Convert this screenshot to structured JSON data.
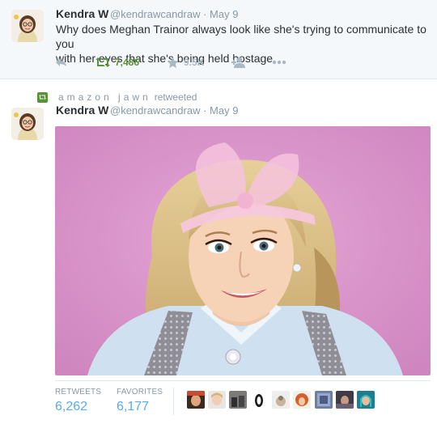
{
  "tweet1": {
    "name": "Kendra W",
    "handle": "@kendrawcandraw",
    "date": "May 9",
    "text_line1": "Why does Meghan Trainor always look like she's trying to communicate to you",
    "text_line2": "with her eyes that she's being held hostage",
    "actions": {
      "reply_icon": "reply-icon",
      "retweet_icon": "retweet-icon",
      "retweet_count": "7,486",
      "favorite_icon": "star-icon",
      "favorite_count": "9.5K",
      "follow_icon": "follow-icon",
      "more_icon": "more-icon"
    }
  },
  "tweet2": {
    "retweeted_by": "amazon jawn",
    "retweeted_label": "retweeted",
    "name": "Kendra W",
    "handle": "@kendrawcandraw",
    "date": "May 9",
    "stats": {
      "retweets_label": "RETWEETS",
      "retweets_value": "6,262",
      "favorites_label": "FAVORITES",
      "favorites_value": "6,177"
    },
    "favoriter_avatars": 10
  },
  "colors": {
    "accent": "#55acee",
    "retweet_green": "#5c913b",
    "muted": "#8899a6",
    "photo_background": "#d993c9"
  }
}
